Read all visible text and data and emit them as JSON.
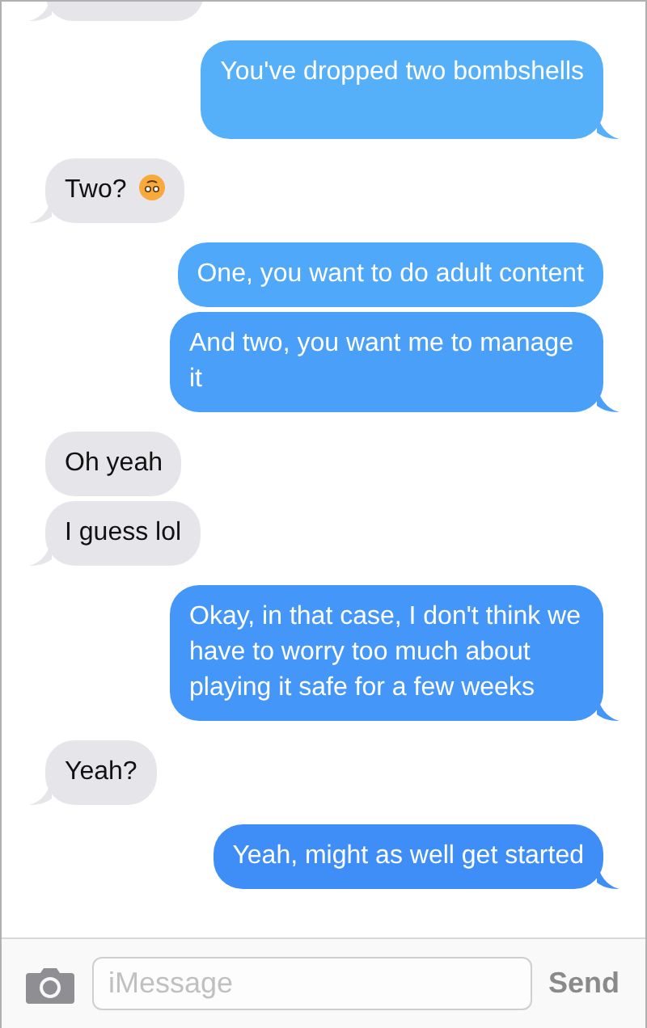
{
  "messages": [
    {
      "kind": "received",
      "tail": true
    },
    {
      "kind": "sent",
      "text": "You've dropped two bombshells",
      "tail": true
    },
    {
      "kind": "received",
      "text": "Two?",
      "emoji": true,
      "tail": true
    },
    {
      "kind": "sent",
      "text": "One, you want to do adult content",
      "tail": false
    },
    {
      "kind": "sent",
      "text": "And two, you want me to manage it",
      "tail": true
    },
    {
      "kind": "received",
      "text": "Oh yeah",
      "tail": false
    },
    {
      "kind": "received",
      "text": "I guess lol",
      "tail": true
    },
    {
      "kind": "sent",
      "text": "Okay, in that case, I don't think we have to worry too much about playing it safe for a few weeks",
      "tail": true
    },
    {
      "kind": "received",
      "text": "Yeah?",
      "tail": true
    },
    {
      "kind": "sent",
      "text": "Yeah, might as well get started",
      "tail": true
    }
  ],
  "composer": {
    "placeholder": "iMessage",
    "send": "Send"
  }
}
